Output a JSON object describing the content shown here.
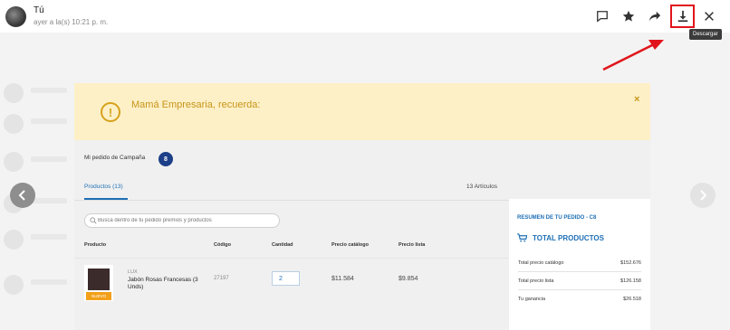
{
  "viewer": {
    "sender": "Tú",
    "sent_time": "ayer a la(s) 10:21 p. m.",
    "tooltip": "Descargar",
    "actions": [
      {
        "name": "comment-button",
        "icon": "comment-icon"
      },
      {
        "name": "star-button",
        "icon": "star-icon"
      },
      {
        "name": "forward-button",
        "icon": "forward-icon"
      },
      {
        "name": "download-button",
        "icon": "download-icon"
      },
      {
        "name": "close-button",
        "icon": "close-icon"
      }
    ],
    "highlight_color": "#e0151b"
  },
  "screenshot": {
    "banner": {
      "text": "Mamá Empresaria, recuerda:",
      "close": "×"
    },
    "order": {
      "label": "Mi pedido de Campaña",
      "badge": "8"
    },
    "tabs": {
      "products": "Productos (13)",
      "articles": "13 Artículos"
    },
    "search": {
      "placeholder": "Busca dentro de tu pedido premios y productos"
    },
    "table": {
      "headers": [
        "Producto",
        "Código",
        "Cantidad",
        "Precio catálogo",
        "Precio lista"
      ],
      "row": {
        "brand": "LUX",
        "name": "Jabón Rosas Francesas (3 Unds)",
        "tag": "NUEVO",
        "code": "27197",
        "quantity": "2",
        "price_catalog": "$11.584",
        "price_list": "$9.854"
      }
    },
    "summary": {
      "title": "RESUMEN DE TU PEDIDO - C8",
      "total_label": "TOTAL PRODUCTOS",
      "lines": [
        {
          "label": "Total precio catálogo",
          "value": "$152.676"
        },
        {
          "label": "Total precio lista",
          "value": "$126.158"
        },
        {
          "label": "Tu ganancia",
          "value": "$26.518"
        }
      ]
    }
  }
}
